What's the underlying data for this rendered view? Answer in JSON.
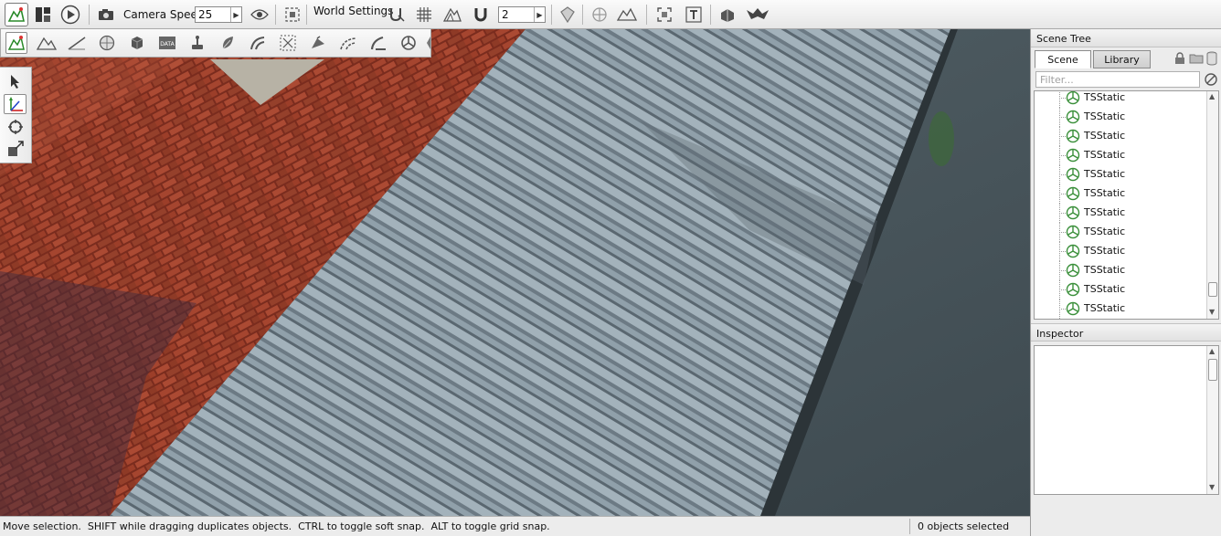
{
  "toolbar": {
    "camera_speed_label": "Camera Speed",
    "camera_speed_value": "25",
    "world_settings_label": "World Settings",
    "grid_snap_value": "2",
    "icons": [
      "world-editor-icon",
      "layout-icon",
      "play-icon",
      "camera-icon",
      "visibility-eye-icon",
      "fit-view-icon",
      "snap-to-terrain-icon",
      "grid-icon",
      "mountain-snap-icon",
      "magnet-icon",
      "object-snap-icon",
      "center-selection-icon",
      "terrain-edit-icon",
      "fit-selection-icon",
      "text-tool-icon",
      "toolbox-icon",
      "bird-icon"
    ]
  },
  "toolbar2": {
    "icons": [
      "object-editor-icon",
      "terrain-editor-icon",
      "terrain-painter-icon",
      "material-editor-icon",
      "sketch-tool-icon",
      "datablock-editor-icon",
      "particle-editor-icon",
      "forest-editor-icon",
      "river-editor-icon",
      "mesh-road-editor-icon",
      "decal-editor-icon",
      "navmesh-editor-icon",
      "road-editor-icon",
      "shape-editor-icon",
      "physics-icon"
    ]
  },
  "palette": {
    "icons": [
      "select-arrow-icon",
      "move-gizmo-icon",
      "rotate-gizmo-icon",
      "scale-gizmo-icon"
    ]
  },
  "scene_tree": {
    "title": "Scene Tree",
    "tabs": [
      "Scene",
      "Library"
    ],
    "filter_placeholder": "Filter...",
    "items": [
      "TSStatic",
      "TSStatic",
      "TSStatic",
      "TSStatic",
      "TSStatic",
      "TSStatic",
      "TSStatic",
      "TSStatic",
      "TSStatic",
      "TSStatic",
      "TSStatic",
      "TSStatic"
    ]
  },
  "inspector": {
    "title": "Inspector"
  },
  "status": {
    "message": "Move selection.  SHIFT while dragging duplicates objects.  CTRL to toggle soft snap.  ALT to toggle grid snap.",
    "selection": "0 objects selected"
  },
  "colors": {
    "brick": "#9a3a26",
    "roof": "#8a99a4",
    "grass": "#4e5c62",
    "accent_green": "#3a8f3a"
  }
}
